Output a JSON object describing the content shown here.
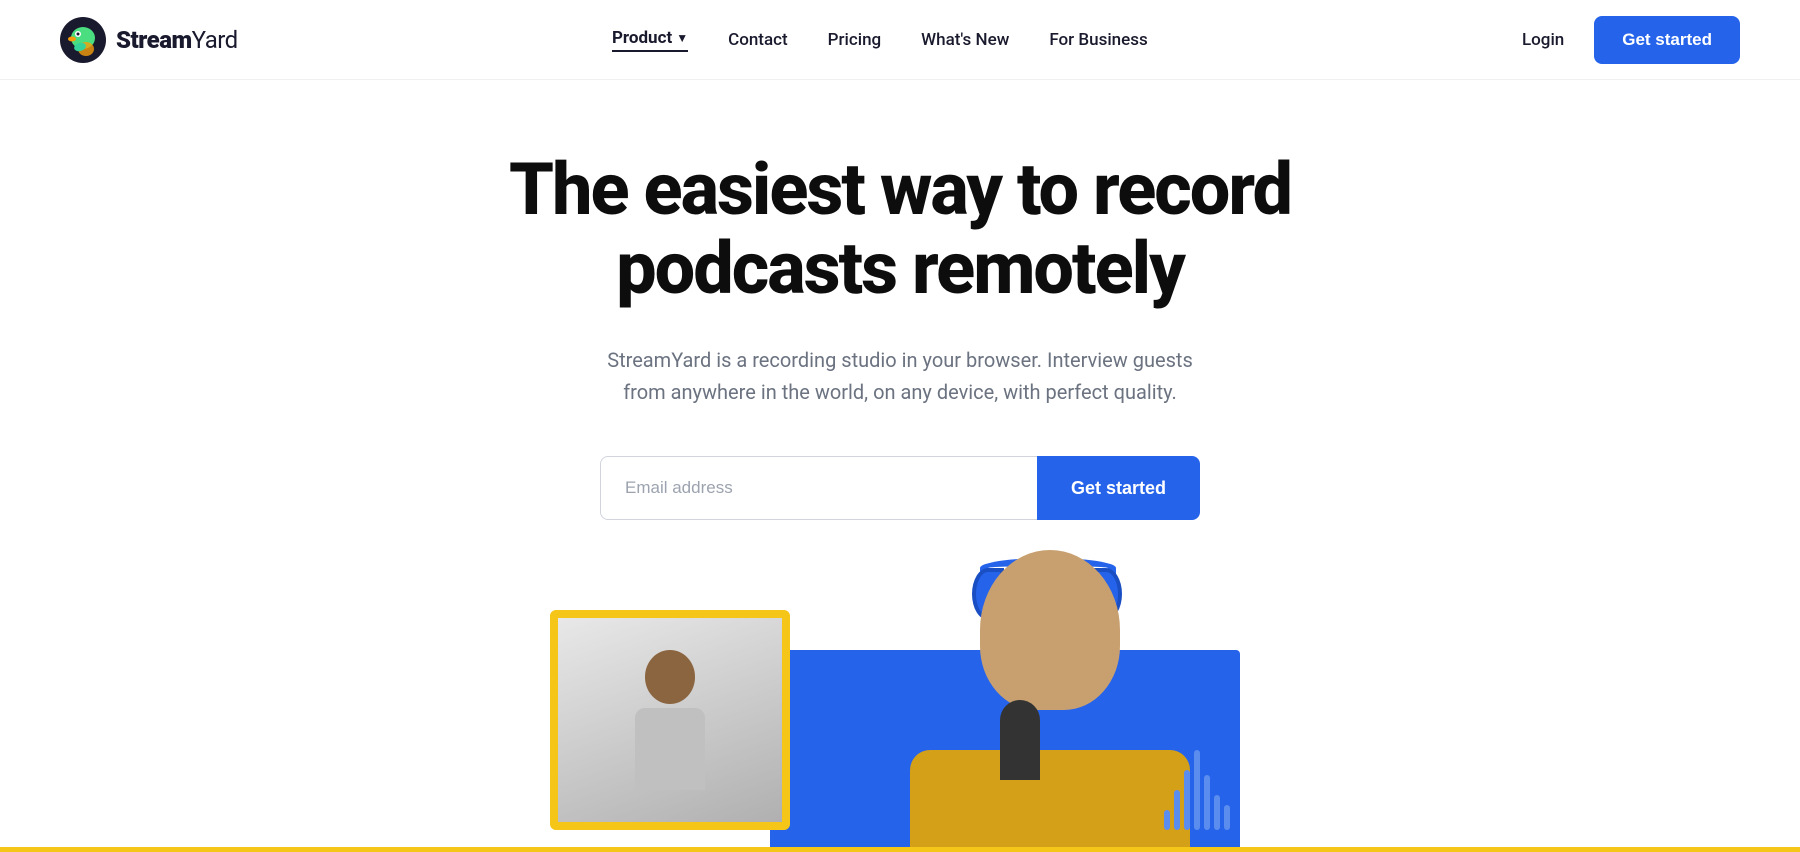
{
  "brand": {
    "name": "StreamYard",
    "name_bold": "Stream",
    "name_regular": "Yard",
    "logo_alt": "StreamYard logo"
  },
  "nav": {
    "items": [
      {
        "id": "product",
        "label": "Product",
        "active": true,
        "has_dropdown": true
      },
      {
        "id": "contact",
        "label": "Contact",
        "active": false,
        "has_dropdown": false
      },
      {
        "id": "pricing",
        "label": "Pricing",
        "active": false,
        "has_dropdown": false
      },
      {
        "id": "whats-new",
        "label": "What's New",
        "active": false,
        "has_dropdown": false
      },
      {
        "id": "for-business",
        "label": "For Business",
        "active": false,
        "has_dropdown": false
      }
    ],
    "login_label": "Login",
    "cta_label": "Get started"
  },
  "hero": {
    "title_line1": "The easiest way to record",
    "title_line2": "podcasts remotely",
    "subtitle": "StreamYard is a recording studio in your browser. Interview guests from anywhere in the world, on any device, with perfect quality.",
    "email_placeholder": "Email address",
    "cta_label": "Get started"
  },
  "colors": {
    "primary": "#2563eb",
    "yellow": "#f5c518",
    "text_dark": "#0d0d0d",
    "text_gray": "#6b7280",
    "border": "#d1d5db"
  }
}
